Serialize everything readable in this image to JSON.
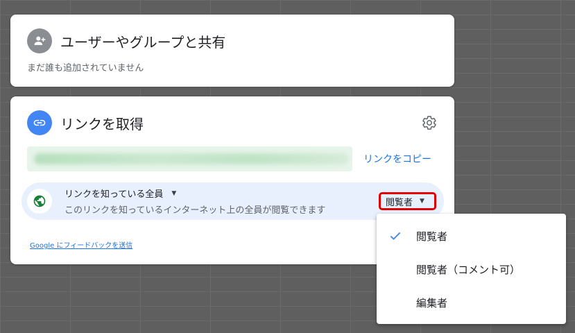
{
  "share": {
    "title": "ユーザーやグループと共有",
    "subtitle": "まだ誰も追加されていません",
    "icon": "add-person-icon"
  },
  "link": {
    "title": "リンクを取得",
    "icon": "link-icon",
    "settings_icon": "gear-icon",
    "copy_label": "リンクをコピー",
    "access": {
      "scope": "リンクを知っている全員",
      "description": "このリンクを知っているインターネット上の全員が閲覧できます",
      "role": "閲覧者",
      "icon": "globe-icon"
    },
    "feedback": "Google にフィードバックを送信"
  },
  "role_menu": {
    "items": [
      {
        "label": "閲覧者",
        "selected": true
      },
      {
        "label": "閲覧者（コメント可）",
        "selected": false
      },
      {
        "label": "編集者",
        "selected": false
      }
    ]
  },
  "colors": {
    "accent": "#1a73e8",
    "link_avatar": "#4285f4",
    "share_avatar": "#8a8d91",
    "access_row_bg": "#e8f0fe",
    "highlight_box": "#e00000",
    "url_field_bg": "#e6f4ea"
  }
}
